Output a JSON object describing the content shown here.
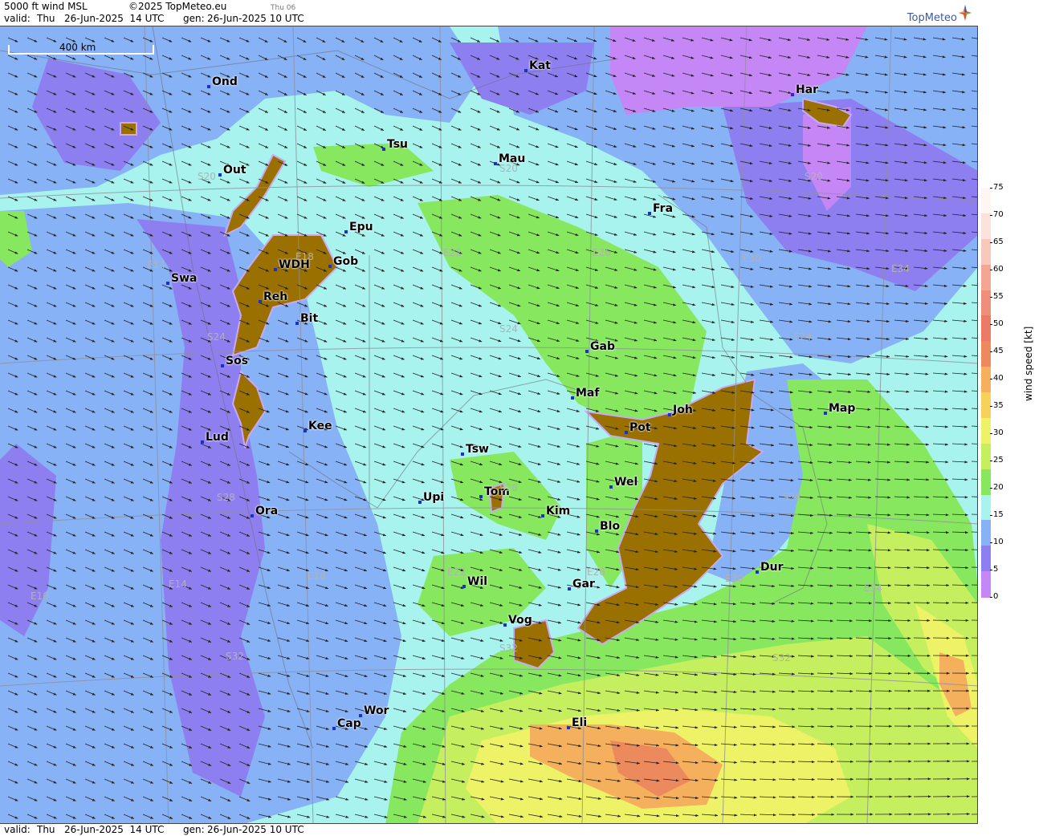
{
  "header": {
    "product": "5000 ft wind MSL",
    "copyright": "©2025 TopMeteo.eu",
    "day_tag": "Thu 06",
    "valid_label": "valid:",
    "valid_time": "Thu   26-Jun-2025  14 UTC",
    "gen_label": "gen:",
    "gen_time": "26-Jun-2025 10 UTC"
  },
  "footer": {
    "valid_label": "valid:",
    "valid_time": "Thu   26-Jun-2025  14 UTC",
    "gen_label": "gen:",
    "gen_time": "26-Jun-2025 10 UTC"
  },
  "logo": {
    "text": "TopMeteo",
    "icon": "compass-star-icon"
  },
  "scale": {
    "label": "400 km"
  },
  "legend": {
    "title": "wind speed  [kt]",
    "ticks": [
      "75",
      "70",
      "65",
      "60",
      "55",
      "50",
      "45",
      "40",
      "35",
      "30",
      "25",
      "20",
      "15",
      "10",
      "5",
      "0"
    ],
    "colors": [
      "#fdf6f3",
      "#fbe2dc",
      "#f8c8bb",
      "#f3a793",
      "#ef8f7a",
      "#ec7b66",
      "#ec8a5e",
      "#f4b05c",
      "#f7d25a",
      "#eef267",
      "#c5ef5f",
      "#87e85f",
      "#a8f3ee",
      "#87b2f6",
      "#8e7ff0",
      "#c587f5"
    ]
  },
  "cities": [
    {
      "name": "Kat"
    },
    {
      "name": "Ond"
    },
    {
      "name": "Har"
    },
    {
      "name": "Tsu"
    },
    {
      "name": "Mau"
    },
    {
      "name": "Out"
    },
    {
      "name": "Fra"
    },
    {
      "name": "Epu"
    },
    {
      "name": "WDH"
    },
    {
      "name": "Gob"
    },
    {
      "name": "Swa"
    },
    {
      "name": "Reh"
    },
    {
      "name": "Bit"
    },
    {
      "name": "Gab"
    },
    {
      "name": "Sos"
    },
    {
      "name": "Maf"
    },
    {
      "name": "Joh"
    },
    {
      "name": "Map"
    },
    {
      "name": "Kee"
    },
    {
      "name": "Pot"
    },
    {
      "name": "Lud"
    },
    {
      "name": "Tsw"
    },
    {
      "name": "Wel"
    },
    {
      "name": "Tom"
    },
    {
      "name": "Upi"
    },
    {
      "name": "Kim"
    },
    {
      "name": "Ora"
    },
    {
      "name": "Blo"
    },
    {
      "name": "Dur"
    },
    {
      "name": "Wil"
    },
    {
      "name": "Gar"
    },
    {
      "name": "Vog"
    },
    {
      "name": "Wor"
    },
    {
      "name": "Cap"
    },
    {
      "name": "Eli"
    }
  ],
  "grid_labels": [
    {
      "text": "S20"
    },
    {
      "text": "E22"
    },
    {
      "text": "E26"
    },
    {
      "text": "E30"
    },
    {
      "text": "E34"
    },
    {
      "text": "S20"
    },
    {
      "text": "E14"
    },
    {
      "text": "E18"
    },
    {
      "text": "S24"
    },
    {
      "text": "S24"
    },
    {
      "text": "S24"
    },
    {
      "text": "S28"
    },
    {
      "text": "S28"
    },
    {
      "text": "S28"
    },
    {
      "text": "E10"
    },
    {
      "text": "E14"
    },
    {
      "text": "E18"
    },
    {
      "text": "E22"
    },
    {
      "text": "E26"
    },
    {
      "text": "E30"
    },
    {
      "text": "E34"
    },
    {
      "text": "S32"
    },
    {
      "text": "S32"
    },
    {
      "text": "S32"
    },
    {
      "text": "S20"
    }
  ]
}
